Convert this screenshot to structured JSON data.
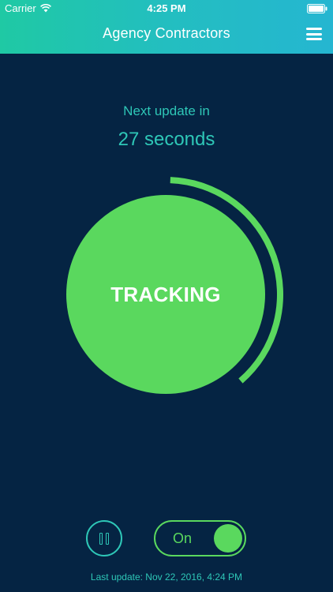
{
  "status_bar": {
    "carrier": "Carrier",
    "time": "4:25 PM"
  },
  "header": {
    "title": "Agency Contractors",
    "menu_icon": "hamburger-menu-icon"
  },
  "countdown": {
    "label": "Next update in",
    "value": "27 seconds",
    "progress_fraction": 0.38
  },
  "tracking": {
    "label": "TRACKING"
  },
  "controls": {
    "pause_icon": "pause-icon",
    "toggle_label": "On",
    "toggle_state": "on"
  },
  "footer": {
    "last_update": "Last update: Nov 22, 2016, 4:24 PM"
  },
  "colors": {
    "background": "#052443",
    "header_start": "#1fc9a4",
    "header_end": "#25b6d1",
    "accent_green": "#5ad85e",
    "accent_teal": "#2ec7b7"
  }
}
